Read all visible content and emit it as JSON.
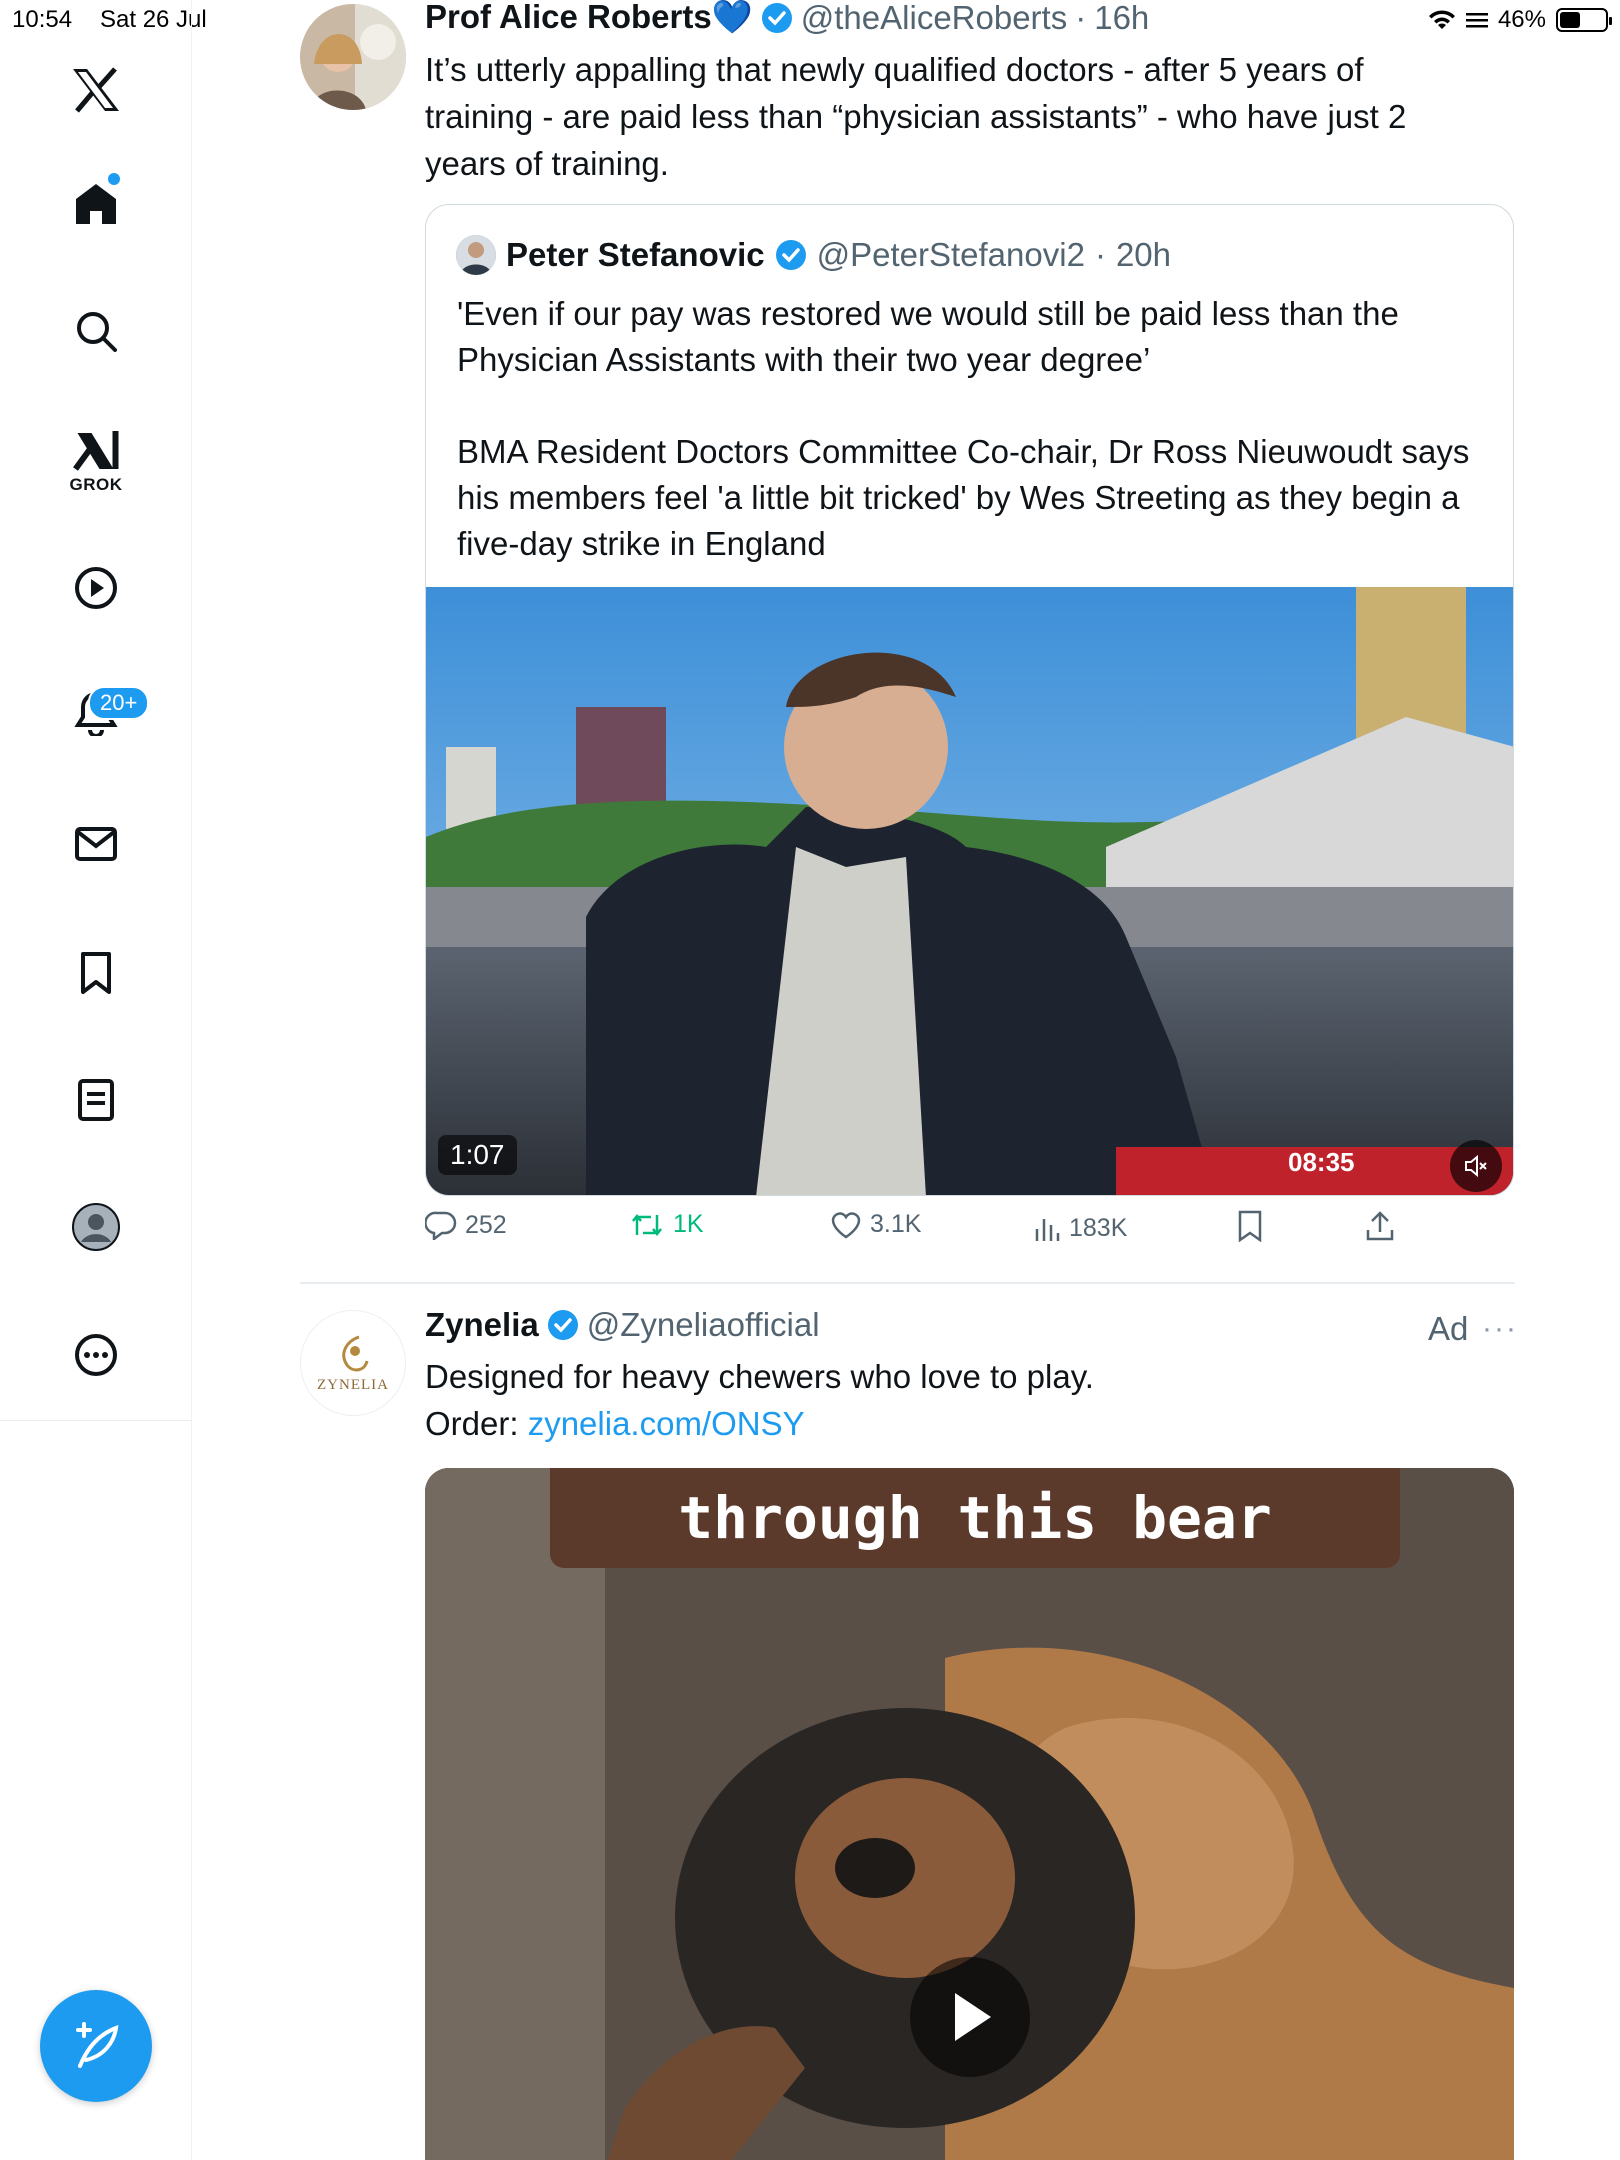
{
  "status_bar": {
    "time": "10:54",
    "date": "Sat 26 Jul",
    "battery": "46%",
    "battery_level": 0.46
  },
  "sidebar": {
    "items": [
      {
        "name": "logo",
        "icon": "x-logo-icon"
      },
      {
        "name": "home",
        "icon": "home-icon"
      },
      {
        "name": "explore",
        "icon": "search-icon"
      },
      {
        "name": "grok",
        "icon": "grok-icon",
        "label": "GROK"
      },
      {
        "name": "video",
        "icon": "play-circle-icon"
      },
      {
        "name": "notifications",
        "icon": "bell-icon",
        "badge": "20+"
      },
      {
        "name": "messages",
        "icon": "mail-icon"
      },
      {
        "name": "bookmarks",
        "icon": "bookmark-icon"
      },
      {
        "name": "lists",
        "icon": "list-icon"
      },
      {
        "name": "profile",
        "icon": "profile-icon"
      },
      {
        "name": "more",
        "icon": "more-circle-icon"
      }
    ],
    "compose_icon": "compose-feather-icon"
  },
  "tweet1": {
    "name": "Prof Alice Roberts💙",
    "handle": "@theAliceRoberts",
    "sep": "·",
    "age": "16h",
    "text_lines": [
      "It’s utterly appalling that newly qualified doctors - after 5 years of",
      "training - are paid less than “physician assistants” - who have just 2",
      "years of training."
    ],
    "quote": {
      "name": "Peter Stefanovic",
      "handle": "@PeterStefanovi2",
      "sep": "·",
      "age": "20h",
      "para1": "'Even if our pay was restored we would still be paid less than the Physician Assistants with their two year degree’",
      "para2": "BMA Resident Doctors Committee Co-chair, Dr Ross Nieuwoudt says his members feel 'a little bit tricked' by Wes Streeting as they begin a five-day strike in England",
      "video": {
        "duration": "1:07",
        "clock": "08:35",
        "mute_icon": "mute-icon"
      }
    },
    "actions": {
      "replies": "252",
      "reposts": "1K",
      "likes": "3.1K",
      "views": "183K"
    }
  },
  "tweet2": {
    "name": "Zynelia",
    "handle": "@Zyneliaofficial",
    "ad_label": "Ad",
    "more": "···",
    "avatar_text": "ZYNELIA",
    "text_line1": "Designed for heavy chewers who love to play.",
    "order_prefix": "Order: ",
    "order_link": "zynelia.com/ONSY",
    "video_caption": "through this bear",
    "play_icon": "play-icon"
  },
  "colors": {
    "accent": "#1d9bf0",
    "repost": "#00ba7c",
    "muted": "#536471",
    "text": "#0f1419"
  }
}
